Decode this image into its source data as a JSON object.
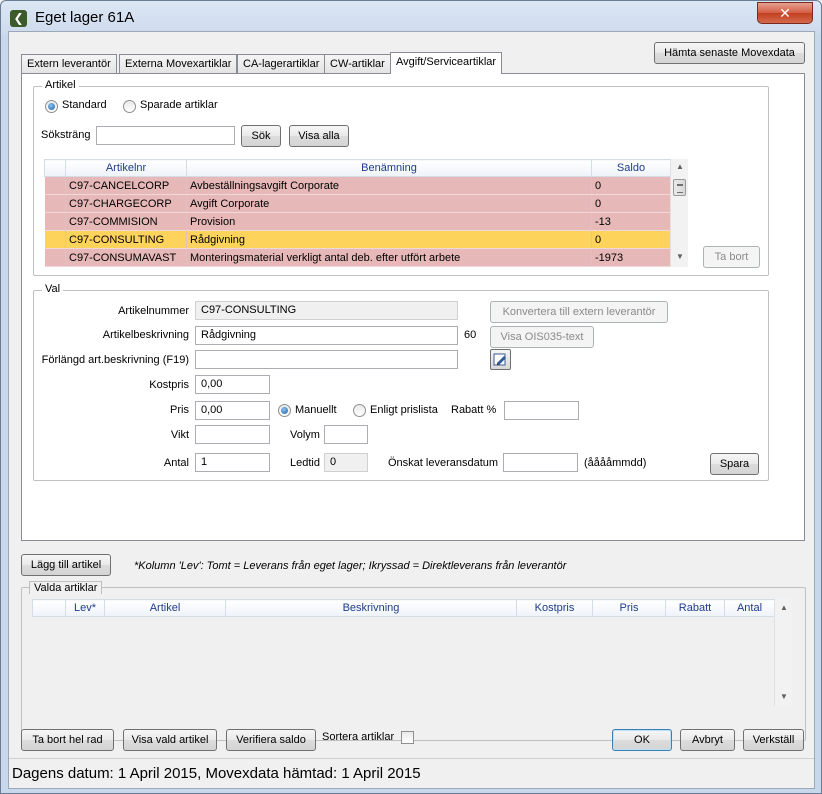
{
  "window": {
    "title": "Eget lager 61A",
    "close_glyph": "✕",
    "app_icon": "back-arrow-icon"
  },
  "header": {
    "fetch_button": "Hämta senaste Movexdata"
  },
  "tabs": [
    {
      "label": "Extern leverantör"
    },
    {
      "label": "Externa Movexartiklar"
    },
    {
      "label": "CA-lagerartiklar"
    },
    {
      "label": "CW-artiklar"
    },
    {
      "label": "Avgift/Serviceartiklar"
    }
  ],
  "artikel": {
    "legend": "Artikel",
    "radio_standard": "Standard",
    "radio_saved": "Sparade artiklar",
    "search_label": "Söksträng",
    "search_value": "",
    "search_button": "Sök",
    "show_all_button": "Visa alla",
    "delete_button": "Ta bort",
    "columns": {
      "artikelnr": "Artikelnr",
      "benamning": "Benämning",
      "saldo": "Saldo"
    },
    "rows": [
      {
        "artikelnr": "C97-CANCELCORP",
        "benamning": "Avbeställningsavgift Corporate",
        "saldo": "0"
      },
      {
        "artikelnr": "C97-CHARGECORP",
        "benamning": "Avgift Corporate",
        "saldo": "0"
      },
      {
        "artikelnr": "C97-COMMISION",
        "benamning": "Provision",
        "saldo": "-13"
      },
      {
        "artikelnr": "C97-CONSULTING",
        "benamning": "Rådgivning",
        "saldo": "0"
      },
      {
        "artikelnr": "C97-CONSUMAVAST",
        "benamning": "Monteringsmaterial verkligt antal deb. efter utfört arbete",
        "saldo": "-1973"
      }
    ]
  },
  "val": {
    "legend": "Val",
    "artikelnummer_label": "Artikelnummer",
    "artikelnummer_value": "C97-CONSULTING",
    "convert_button": "Konvertera till extern leverantör",
    "beskrivning_label": "Artikelbeskrivning",
    "beskrivning_value": "Rådgivning",
    "beskrivning_maxlen": "60",
    "ois_button": "Visa OIS035-text",
    "forlangd_label": "Förlängd art.beskrivning (F19)",
    "forlangd_value": "",
    "kostpris_label": "Kostpris",
    "kostpris_value": "0,00",
    "pris_label": "Pris",
    "pris_value": "0,00",
    "radio_manuellt": "Manuellt",
    "radio_prislista": "Enligt prislista",
    "rabatt_label": "Rabatt %",
    "rabatt_value": "",
    "vikt_label": "Vikt",
    "vikt_value": "",
    "volym_label": "Volym",
    "volym_value": "",
    "antal_label": "Antal",
    "antal_value": "1",
    "ledtid_label": "Ledtid",
    "ledtid_value": "0",
    "leveransdatum_label": "Önskat leveransdatum",
    "leveransdatum_value": "",
    "date_format": "(ååååmmdd)",
    "save_button": "Spara"
  },
  "bottom": {
    "add_button": "Lägg till artikel",
    "note": "*Kolumn 'Lev': Tomt = Leverans från eget lager; Ikryssad = Direktleverans från leverantör",
    "selected_legend": "Valda artiklar",
    "columns": {
      "lev": "Lev*",
      "artikel": "Artikel",
      "beskrivning": "Beskrivning",
      "kostpris": "Kostpris",
      "pris": "Pris",
      "rabatt": "Rabatt",
      "antal": "Antal"
    },
    "delete_row_button": "Ta bort hel rad",
    "show_selected_button": "Visa vald artikel",
    "verify_button": "Verifiera saldo",
    "sort_label": "Sortera artiklar",
    "ok_button": "OK",
    "cancel_button": "Avbryt",
    "execute_button": "Verkställ"
  },
  "status": {
    "text": "Dagens datum: 1 April 2015, Movexdata hämtad: 1 April 2015"
  },
  "colors": {
    "row_red": "#e6b8b8",
    "row_selected": "#fdd35c",
    "header_text": "#1f3c88"
  }
}
